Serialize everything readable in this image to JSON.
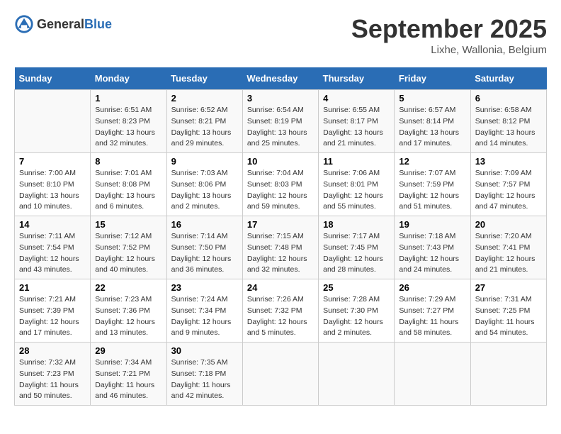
{
  "header": {
    "logo": {
      "general": "General",
      "blue": "Blue"
    },
    "title": "September 2025",
    "location": "Lixhe, Wallonia, Belgium"
  },
  "calendar": {
    "days_of_week": [
      "Sunday",
      "Monday",
      "Tuesday",
      "Wednesday",
      "Thursday",
      "Friday",
      "Saturday"
    ],
    "weeks": [
      [
        {
          "day": "",
          "info": ""
        },
        {
          "day": "1",
          "sunrise": "Sunrise: 6:51 AM",
          "sunset": "Sunset: 8:23 PM",
          "daylight": "Daylight: 13 hours and 32 minutes."
        },
        {
          "day": "2",
          "sunrise": "Sunrise: 6:52 AM",
          "sunset": "Sunset: 8:21 PM",
          "daylight": "Daylight: 13 hours and 29 minutes."
        },
        {
          "day": "3",
          "sunrise": "Sunrise: 6:54 AM",
          "sunset": "Sunset: 8:19 PM",
          "daylight": "Daylight: 13 hours and 25 minutes."
        },
        {
          "day": "4",
          "sunrise": "Sunrise: 6:55 AM",
          "sunset": "Sunset: 8:17 PM",
          "daylight": "Daylight: 13 hours and 21 minutes."
        },
        {
          "day": "5",
          "sunrise": "Sunrise: 6:57 AM",
          "sunset": "Sunset: 8:14 PM",
          "daylight": "Daylight: 13 hours and 17 minutes."
        },
        {
          "day": "6",
          "sunrise": "Sunrise: 6:58 AM",
          "sunset": "Sunset: 8:12 PM",
          "daylight": "Daylight: 13 hours and 14 minutes."
        }
      ],
      [
        {
          "day": "7",
          "sunrise": "Sunrise: 7:00 AM",
          "sunset": "Sunset: 8:10 PM",
          "daylight": "Daylight: 13 hours and 10 minutes."
        },
        {
          "day": "8",
          "sunrise": "Sunrise: 7:01 AM",
          "sunset": "Sunset: 8:08 PM",
          "daylight": "Daylight: 13 hours and 6 minutes."
        },
        {
          "day": "9",
          "sunrise": "Sunrise: 7:03 AM",
          "sunset": "Sunset: 8:06 PM",
          "daylight": "Daylight: 13 hours and 2 minutes."
        },
        {
          "day": "10",
          "sunrise": "Sunrise: 7:04 AM",
          "sunset": "Sunset: 8:03 PM",
          "daylight": "Daylight: 12 hours and 59 minutes."
        },
        {
          "day": "11",
          "sunrise": "Sunrise: 7:06 AM",
          "sunset": "Sunset: 8:01 PM",
          "daylight": "Daylight: 12 hours and 55 minutes."
        },
        {
          "day": "12",
          "sunrise": "Sunrise: 7:07 AM",
          "sunset": "Sunset: 7:59 PM",
          "daylight": "Daylight: 12 hours and 51 minutes."
        },
        {
          "day": "13",
          "sunrise": "Sunrise: 7:09 AM",
          "sunset": "Sunset: 7:57 PM",
          "daylight": "Daylight: 12 hours and 47 minutes."
        }
      ],
      [
        {
          "day": "14",
          "sunrise": "Sunrise: 7:11 AM",
          "sunset": "Sunset: 7:54 PM",
          "daylight": "Daylight: 12 hours and 43 minutes."
        },
        {
          "day": "15",
          "sunrise": "Sunrise: 7:12 AM",
          "sunset": "Sunset: 7:52 PM",
          "daylight": "Daylight: 12 hours and 40 minutes."
        },
        {
          "day": "16",
          "sunrise": "Sunrise: 7:14 AM",
          "sunset": "Sunset: 7:50 PM",
          "daylight": "Daylight: 12 hours and 36 minutes."
        },
        {
          "day": "17",
          "sunrise": "Sunrise: 7:15 AM",
          "sunset": "Sunset: 7:48 PM",
          "daylight": "Daylight: 12 hours and 32 minutes."
        },
        {
          "day": "18",
          "sunrise": "Sunrise: 7:17 AM",
          "sunset": "Sunset: 7:45 PM",
          "daylight": "Daylight: 12 hours and 28 minutes."
        },
        {
          "day": "19",
          "sunrise": "Sunrise: 7:18 AM",
          "sunset": "Sunset: 7:43 PM",
          "daylight": "Daylight: 12 hours and 24 minutes."
        },
        {
          "day": "20",
          "sunrise": "Sunrise: 7:20 AM",
          "sunset": "Sunset: 7:41 PM",
          "daylight": "Daylight: 12 hours and 21 minutes."
        }
      ],
      [
        {
          "day": "21",
          "sunrise": "Sunrise: 7:21 AM",
          "sunset": "Sunset: 7:39 PM",
          "daylight": "Daylight: 12 hours and 17 minutes."
        },
        {
          "day": "22",
          "sunrise": "Sunrise: 7:23 AM",
          "sunset": "Sunset: 7:36 PM",
          "daylight": "Daylight: 12 hours and 13 minutes."
        },
        {
          "day": "23",
          "sunrise": "Sunrise: 7:24 AM",
          "sunset": "Sunset: 7:34 PM",
          "daylight": "Daylight: 12 hours and 9 minutes."
        },
        {
          "day": "24",
          "sunrise": "Sunrise: 7:26 AM",
          "sunset": "Sunset: 7:32 PM",
          "daylight": "Daylight: 12 hours and 5 minutes."
        },
        {
          "day": "25",
          "sunrise": "Sunrise: 7:28 AM",
          "sunset": "Sunset: 7:30 PM",
          "daylight": "Daylight: 12 hours and 2 minutes."
        },
        {
          "day": "26",
          "sunrise": "Sunrise: 7:29 AM",
          "sunset": "Sunset: 7:27 PM",
          "daylight": "Daylight: 11 hours and 58 minutes."
        },
        {
          "day": "27",
          "sunrise": "Sunrise: 7:31 AM",
          "sunset": "Sunset: 7:25 PM",
          "daylight": "Daylight: 11 hours and 54 minutes."
        }
      ],
      [
        {
          "day": "28",
          "sunrise": "Sunrise: 7:32 AM",
          "sunset": "Sunset: 7:23 PM",
          "daylight": "Daylight: 11 hours and 50 minutes."
        },
        {
          "day": "29",
          "sunrise": "Sunrise: 7:34 AM",
          "sunset": "Sunset: 7:21 PM",
          "daylight": "Daylight: 11 hours and 46 minutes."
        },
        {
          "day": "30",
          "sunrise": "Sunrise: 7:35 AM",
          "sunset": "Sunset: 7:18 PM",
          "daylight": "Daylight: 11 hours and 42 minutes."
        },
        {
          "day": "",
          "info": ""
        },
        {
          "day": "",
          "info": ""
        },
        {
          "day": "",
          "info": ""
        },
        {
          "day": "",
          "info": ""
        }
      ]
    ]
  }
}
